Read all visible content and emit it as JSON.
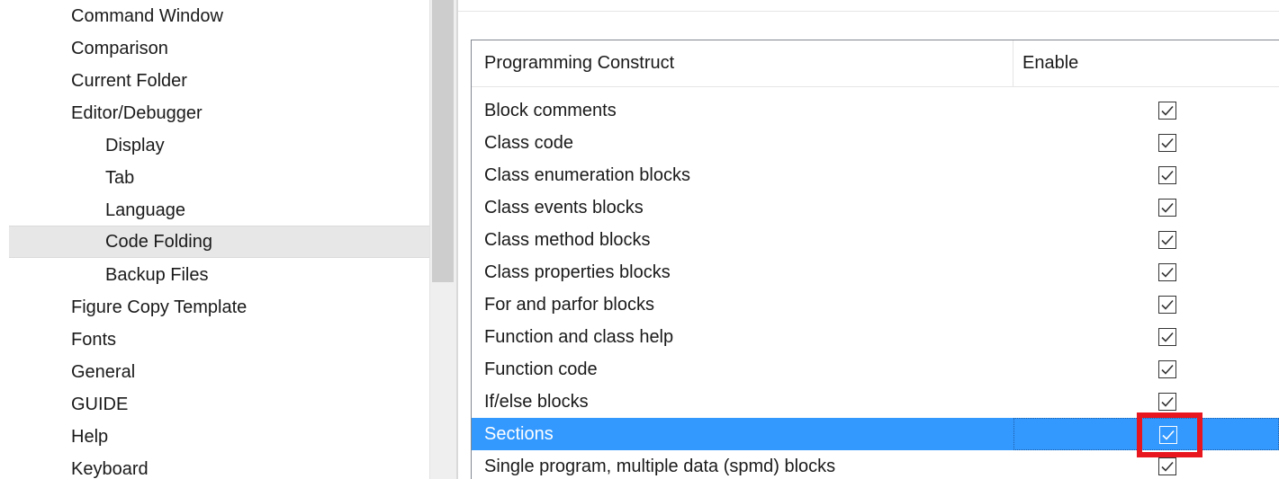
{
  "tree": {
    "items": [
      {
        "label": "Command Window"
      },
      {
        "label": "Comparison"
      },
      {
        "label": "Current Folder"
      },
      {
        "label": "Editor/Debugger"
      },
      {
        "label": "Display"
      },
      {
        "label": "Tab"
      },
      {
        "label": "Language"
      },
      {
        "label": "Code Folding"
      },
      {
        "label": "Backup Files"
      },
      {
        "label": "Figure Copy Template"
      },
      {
        "label": "Fonts"
      },
      {
        "label": "General"
      },
      {
        "label": "GUIDE"
      },
      {
        "label": "Help"
      },
      {
        "label": "Keyboard"
      }
    ],
    "selected": "Code Folding"
  },
  "table": {
    "headers": {
      "construct": "Programming Construct",
      "enable": "Enable"
    },
    "rows": [
      {
        "label": "Block comments",
        "enabled": true
      },
      {
        "label": "Class code",
        "enabled": true
      },
      {
        "label": "Class enumeration blocks",
        "enabled": true
      },
      {
        "label": "Class events blocks",
        "enabled": true
      },
      {
        "label": "Class method blocks",
        "enabled": true
      },
      {
        "label": "Class properties blocks",
        "enabled": true
      },
      {
        "label": "For and parfor blocks",
        "enabled": true
      },
      {
        "label": "Function and class help",
        "enabled": true
      },
      {
        "label": "Function code",
        "enabled": true
      },
      {
        "label": "If/else blocks",
        "enabled": true
      },
      {
        "label": "Sections",
        "enabled": true
      },
      {
        "label": "Single program, multiple data (spmd) blocks",
        "enabled": true
      }
    ],
    "selected_row": "Sections"
  },
  "colors": {
    "selection": "#3399ff",
    "tree_selection": "#e7e7e7",
    "annotation": "#e8161f"
  },
  "icons": {
    "checkbox": "checkmark-icon"
  }
}
